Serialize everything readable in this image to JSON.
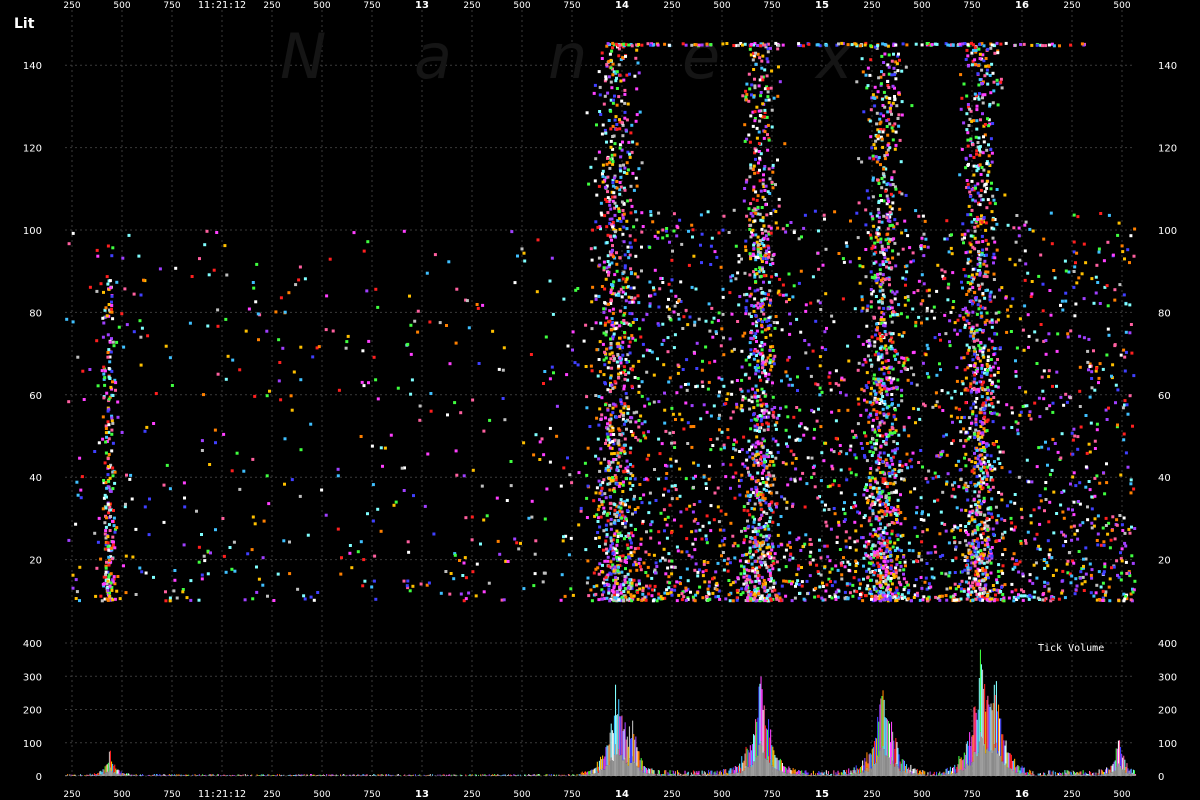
{
  "chart_data": {
    "type": "scatter",
    "title": "Lit",
    "watermark": "Nanex",
    "time_label": "11:21:12",
    "volume_label": "Tick Volume",
    "x_ticks": [
      "250",
      "500",
      "750",
      "11:21:12",
      "250",
      "500",
      "750",
      "13",
      "250",
      "500",
      "750",
      "14",
      "250",
      "500",
      "750",
      "15",
      "250",
      "500",
      "750",
      "16",
      "250",
      "500"
    ],
    "x_bold_ticks": [
      "13",
      "14",
      "15",
      "16"
    ],
    "price_axis": {
      "ylim": [
        0,
        150
      ],
      "ticks": [
        20,
        40,
        60,
        80,
        100,
        120,
        140
      ]
    },
    "volume_axis": {
      "ylim": [
        0,
        400
      ],
      "ticks": [
        0,
        100,
        200,
        300,
        400
      ]
    },
    "x_range": [
      0,
      1000
    ],
    "series_colors": [
      "#ff2020",
      "#ff40ff",
      "#4040ff",
      "#40c0ff",
      "#a040ff",
      "#ffffff",
      "#40ff40",
      "#ffc000",
      "#ff8000",
      "#c0c0c0",
      "#ff60a0",
      "#80ffff"
    ],
    "density_clusters": [
      {
        "center": 42,
        "width": 6,
        "intensity": 0.25,
        "ymax": 90
      },
      {
        "center": 515,
        "width": 18,
        "intensity": 1.0,
        "ymax": 145
      },
      {
        "center": 650,
        "width": 14,
        "intensity": 0.85,
        "ymax": 145
      },
      {
        "center": 765,
        "width": 16,
        "intensity": 1.0,
        "ymax": 145
      },
      {
        "center": 855,
        "width": 16,
        "intensity": 1.0,
        "ymax": 145
      }
    ],
    "volume_peaks": [
      {
        "x": 42,
        "value": 85
      },
      {
        "x": 515,
        "value": 300
      },
      {
        "x": 530,
        "value": 140
      },
      {
        "x": 650,
        "value": 350
      },
      {
        "x": 765,
        "value": 335
      },
      {
        "x": 855,
        "value": 350
      },
      {
        "x": 870,
        "value": 240
      },
      {
        "x": 985,
        "value": 130
      }
    ]
  }
}
